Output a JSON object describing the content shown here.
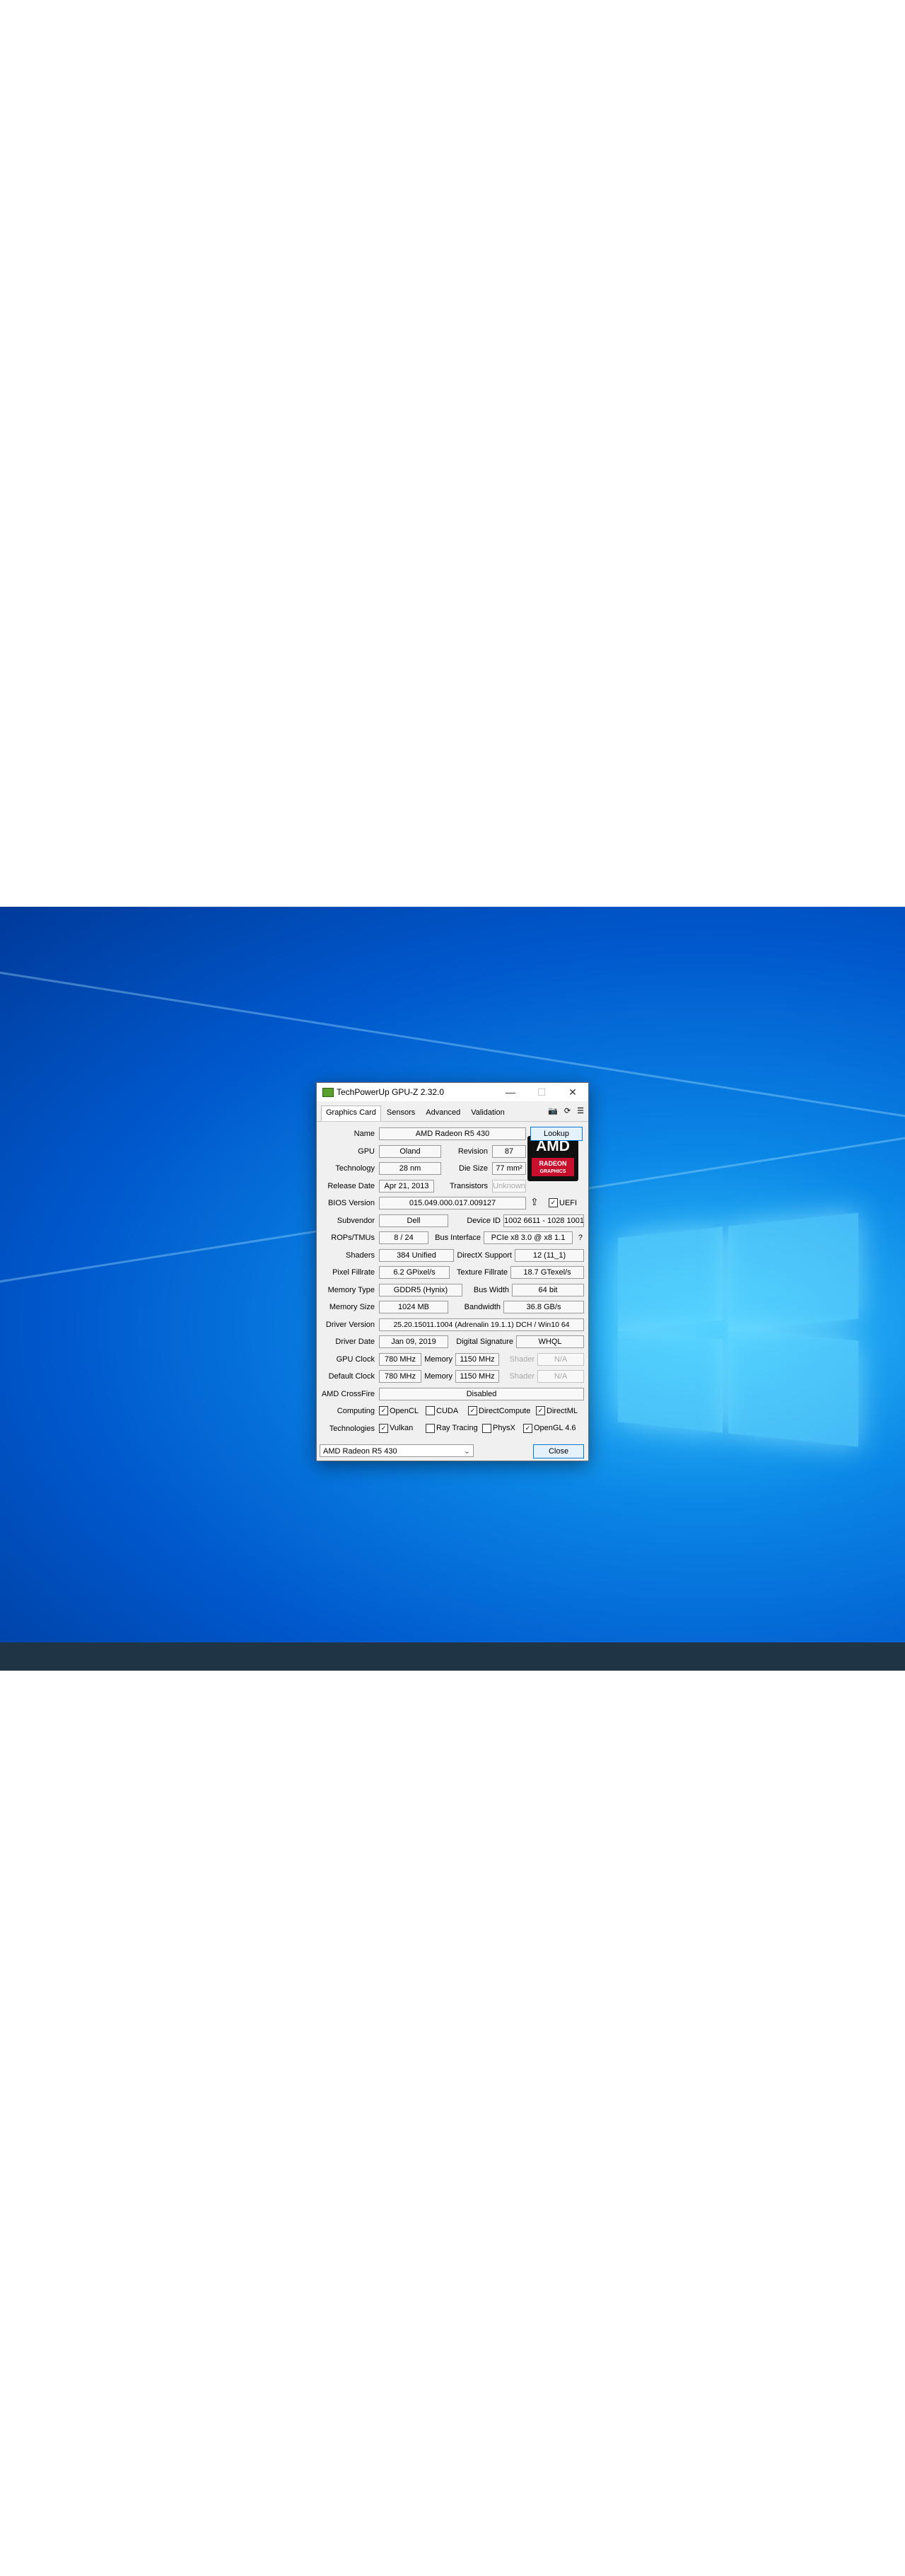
{
  "window": {
    "title": "TechPowerUp GPU-Z 2.32.0",
    "minimize": "—",
    "maximize": "☐",
    "close": "✕"
  },
  "tabs": [
    "Graphics Card",
    "Sensors",
    "Advanced",
    "Validation"
  ],
  "tab_icons": [
    "camera-icon",
    "refresh-icon",
    "menu-icon"
  ],
  "fields": {
    "name": {
      "label": "Name",
      "value": "AMD Radeon R5 430"
    },
    "lookup": "Lookup",
    "gpu": {
      "label": "GPU",
      "value": "Oland"
    },
    "revision": {
      "label": "Revision",
      "value": "87"
    },
    "technology": {
      "label": "Technology",
      "value": "28 nm"
    },
    "die_size": {
      "label": "Die Size",
      "value": "77 mm²"
    },
    "release_date": {
      "label": "Release Date",
      "value": "Apr 21, 2013"
    },
    "transistors": {
      "label": "Transistors",
      "value": "Unknown"
    },
    "bios": {
      "label": "BIOS Version",
      "value": "015.049.000.017.009127"
    },
    "uefi": "UEFI",
    "subvendor": {
      "label": "Subvendor",
      "value": "Dell"
    },
    "device_id": {
      "label": "Device ID",
      "value": "1002 6611 - 1028 1001"
    },
    "rops": {
      "label": "ROPs/TMUs",
      "value": "8 / 24"
    },
    "bus_interface": {
      "label": "Bus Interface",
      "value": "PCIe x8 3.0 @ x8 1.1"
    },
    "help": "?",
    "shaders": {
      "label": "Shaders",
      "value": "384 Unified"
    },
    "directx": {
      "label": "DirectX Support",
      "value": "12 (11_1)"
    },
    "pixel_fillrate": {
      "label": "Pixel Fillrate",
      "value": "6.2 GPixel/s"
    },
    "texture_fillrate": {
      "label": "Texture Fillrate",
      "value": "18.7 GTexel/s"
    },
    "memory_type": {
      "label": "Memory Type",
      "value": "GDDR5 (Hynix)"
    },
    "bus_width": {
      "label": "Bus Width",
      "value": "64 bit"
    },
    "memory_size": {
      "label": "Memory Size",
      "value": "1024 MB"
    },
    "bandwidth": {
      "label": "Bandwidth",
      "value": "36.8 GB/s"
    },
    "driver_version": {
      "label": "Driver Version",
      "value": "25.20.15011.1004 (Adrenalin 19.1.1) DCH / Win10 64"
    },
    "driver_date": {
      "label": "Driver Date",
      "value": "Jan 09, 2019"
    },
    "digital_signature": {
      "label": "Digital Signature",
      "value": "WHQL"
    },
    "gpu_clock": {
      "label": "GPU Clock",
      "value": "780 MHz",
      "memory_label": "Memory",
      "memory_value": "1150 MHz",
      "shader_label": "Shader",
      "shader_value": "N/A"
    },
    "default_clock": {
      "label": "Default Clock",
      "value": "780 MHz",
      "memory_label": "Memory",
      "memory_value": "1150 MHz",
      "shader_label": "Shader",
      "shader_value": "N/A"
    },
    "crossfire": {
      "label": "AMD CrossFire",
      "value": "Disabled"
    }
  },
  "computing": {
    "label": "Computing",
    "items": [
      {
        "name": "OpenCL",
        "checked": true
      },
      {
        "name": "CUDA",
        "checked": false
      },
      {
        "name": "DirectCompute",
        "checked": true
      },
      {
        "name": "DirectML",
        "checked": true
      }
    ]
  },
  "technologies": {
    "label": "Technologies",
    "items": [
      {
        "name": "Vulkan",
        "checked": true
      },
      {
        "name": "Ray Tracing",
        "checked": false
      },
      {
        "name": "PhysX",
        "checked": false
      },
      {
        "name": "OpenGL 4.6",
        "checked": true
      }
    ]
  },
  "logo": {
    "brand": "AMD",
    "sub1": "RADEON",
    "sub2": "GRAPHICS"
  },
  "footer": {
    "selected_gpu": "AMD Radeon R5 430",
    "close": "Close"
  },
  "colors": {
    "desktop": "#0a86e6",
    "taskbar": "#1f3444",
    "radeon_red": "#c8102e"
  }
}
